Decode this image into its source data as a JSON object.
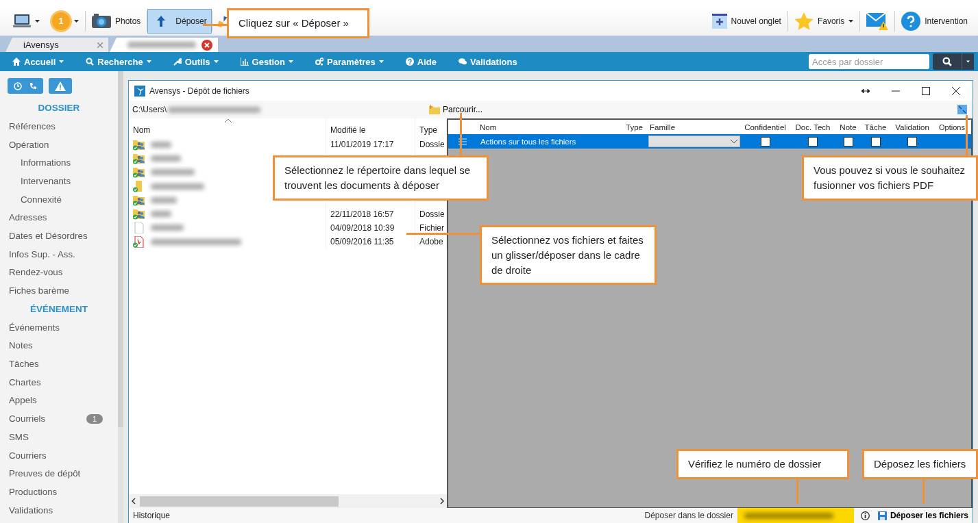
{
  "toolbar": {
    "left": [
      {
        "kind": "monitor",
        "caret": true,
        "selected": false
      },
      {
        "kind": "notification",
        "badge": "1",
        "caret": true,
        "selected": false
      },
      {
        "kind": "camera",
        "label": "Photos",
        "caret": false,
        "selected": false
      },
      {
        "kind": "upload",
        "label": "Déposer",
        "caret": false,
        "selected": true
      },
      {
        "kind": "broom",
        "caret": false,
        "selected": false
      }
    ],
    "right": [
      {
        "kind": "new-tab",
        "label": "Nouvel onglet",
        "caret": false
      },
      {
        "kind": "star",
        "label": "Favoris",
        "caret": true
      },
      {
        "kind": "mail-warning",
        "caret": false
      },
      {
        "kind": "help",
        "label": "Intervention",
        "caret": false
      }
    ]
  },
  "tabs": [
    {
      "label": "iAvensys",
      "selected": false
    },
    {
      "selected": true
    }
  ],
  "nav": {
    "items": [
      {
        "kind": "home",
        "label": "Accueil",
        "caret": true
      },
      {
        "kind": "search",
        "label": "Recherche",
        "caret": true
      },
      {
        "kind": "wrench",
        "label": "Outils",
        "caret": true
      },
      {
        "kind": "chart",
        "label": "Gestion",
        "caret": true
      },
      {
        "kind": "gears",
        "label": "Paramètres",
        "caret": true
      },
      {
        "kind": "help",
        "label": "Aide",
        "caret": false
      },
      {
        "kind": "chat",
        "label": "Validations",
        "caret": false
      }
    ],
    "search": {
      "placeholder": "Accès par dossier"
    }
  },
  "sidebar": {
    "sections": [
      {
        "title": "DOSSIER",
        "items": [
          {
            "label": "Références"
          },
          {
            "label": "Opération",
            "children": [
              {
                "label": "Informations"
              },
              {
                "label": "Intervenants"
              },
              {
                "label": "Connexité"
              }
            ]
          },
          {
            "label": "Adresses"
          },
          {
            "label": "Dates et Désordres"
          },
          {
            "label": "Infos Sup. - Ass."
          },
          {
            "label": "Rendez-vous"
          },
          {
            "label": "Fiches barème"
          }
        ]
      },
      {
        "title": "ÉVÉNEMENT",
        "items": [
          {
            "label": "Événements"
          },
          {
            "label": "Notes"
          },
          {
            "label": "Tâches"
          },
          {
            "label": "Chartes"
          },
          {
            "label": "Appels"
          },
          {
            "label": "Courriels",
            "badge": "1"
          },
          {
            "label": "SMS"
          },
          {
            "label": "Courriers"
          },
          {
            "label": "Preuves de dépôt"
          },
          {
            "label": "Productions"
          },
          {
            "label": "Validations"
          }
        ]
      }
    ]
  },
  "dialog": {
    "title": "Avensys - Dépôt de fichiers",
    "path": "C:\\Users\\",
    "browse": "Parcourir...",
    "file_list": {
      "columns": [
        "Nom",
        "Modifié le",
        "Type"
      ],
      "rows": [
        {
          "kind": "shared-folder",
          "modified": "11/01/2019 17:17",
          "type": "Dossie"
        },
        {
          "kind": "shared-folder"
        },
        {
          "kind": "shared-folder"
        },
        {
          "kind": "folder"
        },
        {
          "kind": "shared-folder"
        },
        {
          "kind": "shared-folder",
          "modified": "22/11/2018 16:57",
          "type": "Dossie"
        },
        {
          "kind": "file",
          "modified": "04/09/2018 10:39",
          "type": "Fichier"
        },
        {
          "kind": "pdf",
          "modified": "05/09/2016 11:35",
          "type": "Adobe"
        }
      ]
    },
    "grid": {
      "columns": [
        "Nom",
        "Type",
        "Famille",
        "Confidentiel",
        "Doc. Tech",
        "Note",
        "Tâche",
        "Validation",
        "Options"
      ],
      "rows": [
        {
          "label": "Actions sur tous les fichiers",
          "selected": true,
          "checks": [
            false,
            false,
            false,
            false,
            false
          ]
        }
      ]
    },
    "status": {
      "history": "Historique",
      "target_label": "Déposer dans le dossier",
      "submit": "Déposer les fichiers"
    }
  },
  "callouts": [
    {
      "text": "Cliquez sur « Déposer »"
    },
    {
      "text": "Sélectionnez le répertoire dans lequel se trouvent les documents à déposer"
    },
    {
      "text": "Sélectionnez vos fichiers et faites un glisser/déposer dans le cadre de droite"
    },
    {
      "text": "Vous pouvez si vous le souhaitez fusionner vos fichiers PDF"
    },
    {
      "text": "Vérifiez le numéro de dossier"
    },
    {
      "text": "Déposez les fichiers"
    }
  ]
}
